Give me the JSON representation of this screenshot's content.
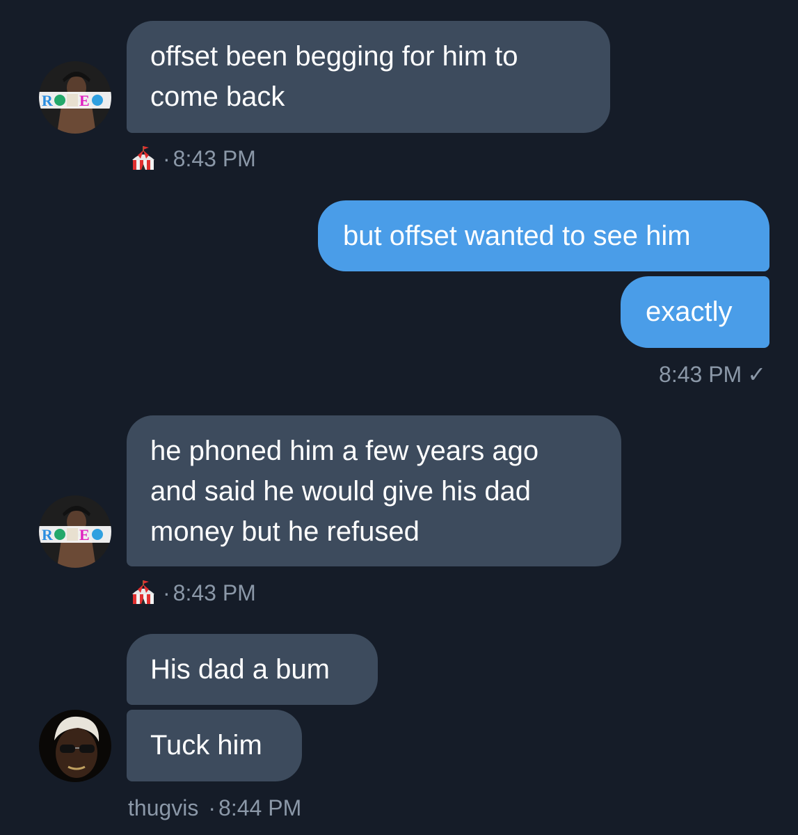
{
  "messages": [
    {
      "sender": "incoming",
      "lines": [
        "offset been begging for him to",
        "come back"
      ],
      "meta_time": "8:43 PM"
    },
    {
      "sender": "outgoing",
      "lines": [
        "but offset wanted to see him"
      ]
    },
    {
      "sender": "outgoing",
      "lines": [
        "exactly"
      ],
      "meta_time": "8:43 PM",
      "meta_check": "✓"
    },
    {
      "sender": "incoming",
      "lines": [
        "he phoned him a few years ago",
        "and said he would give his dad",
        "money but he refused"
      ],
      "meta_time": "8:43 PM"
    },
    {
      "sender": "incoming",
      "lines": [
        "His dad a bum"
      ]
    },
    {
      "sender": "incoming",
      "lines": [
        "Tuck him"
      ],
      "meta_name": "thugvis",
      "meta_time": "8:44 PM"
    }
  ],
  "avatars": {
    "rodeo_text": "RODEO"
  },
  "separator": "·",
  "colors": {
    "background": "#151c28",
    "incoming_bubble": "#3d4b5d",
    "outgoing_bubble": "#4a9de8",
    "meta_text": "#8b98a8"
  },
  "icons": {
    "circus_tent": "circus-tent-icon",
    "read_check": "check-icon"
  }
}
